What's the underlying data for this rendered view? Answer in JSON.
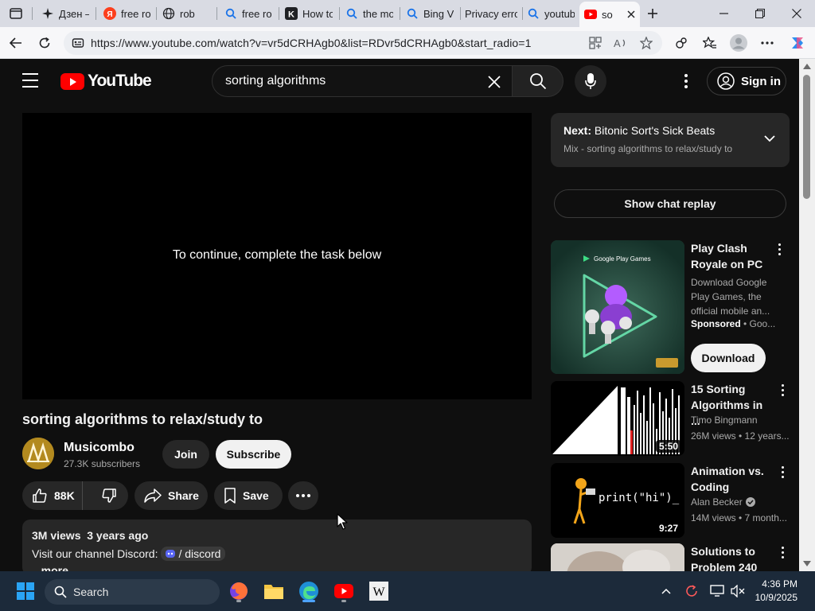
{
  "browser": {
    "tabs": [
      {
        "label": "Дзен —",
        "icon": "dzen-icon",
        "active": false
      },
      {
        "label": "free rob",
        "icon": "yandex-icon",
        "active": false
      },
      {
        "label": "rob",
        "icon": "globe-icon",
        "active": false
      },
      {
        "label": "free rob",
        "icon": "search-icon",
        "active": false
      },
      {
        "label": "How to",
        "icon": "k-icon",
        "active": false
      },
      {
        "label": "the mo",
        "icon": "search-icon",
        "active": false
      },
      {
        "label": "Bing Vi",
        "icon": "search-icon",
        "active": false
      },
      {
        "label": "Privacy error",
        "icon": "none",
        "active": false
      },
      {
        "label": "youtube",
        "icon": "search-icon",
        "active": false
      },
      {
        "label": "so",
        "icon": "youtube-icon",
        "active": true
      }
    ],
    "url": "https://www.youtube.com/watch?v=vr5dCRHAgb0&list=RDvr5dCRHAgb0&start_radio=1"
  },
  "youtube": {
    "logo_text": "YouTube",
    "search_query": "sorting algorithms",
    "sign_in": "Sign in",
    "player_message": "To continue, complete the task below",
    "video_title": "sorting algorithms to relax/study to",
    "channel": {
      "name": "Musicombo",
      "subscribers": "27.3K subscribers",
      "join": "Join",
      "subscribe": "Subscribe"
    },
    "actions": {
      "likes": "88K",
      "share": "Share",
      "save": "Save"
    },
    "description": {
      "meta": "3M views  3 years ago",
      "line": "Visit our channel Discord:",
      "discord": "/ discord",
      "more": "...more"
    },
    "next": {
      "label": "Next:",
      "title": "Bitonic Sort's Sick Beats",
      "playlist": "Mix - sorting algorithms to relax/study to"
    },
    "chat_replay": "Show chat replay",
    "ad": {
      "title": "Play Clash Royale on PC",
      "description": "Download Google Play Games, the official mobile an...",
      "sponsored": "Sponsored",
      "advertiser": "Goo...",
      "thumb_brand": "Google Play Games",
      "download": "Download"
    },
    "recommendations": [
      {
        "title": "15 Sorting Algorithms in ...",
        "channel": "Timo Bingmann",
        "stats": "26M views • 12 years...",
        "duration": "5:50",
        "verified": false
      },
      {
        "title": "Animation vs. Coding",
        "channel": "Alan Becker",
        "stats": "14M views • 7 month...",
        "duration": "9:27",
        "verified": true,
        "thumb_text": "print(\"hi\")_"
      },
      {
        "title": "Solutions to Problem 240",
        "channel": "",
        "stats": "",
        "duration": "",
        "verified": false
      }
    ]
  },
  "taskbar": {
    "search_label": "Search",
    "time": "4:36 PM",
    "date": "10/9/2025"
  },
  "colors": {
    "yt_bg": "#0f0f0f",
    "yt_red": "#ff0000",
    "taskbar": "#1c2a3a"
  }
}
